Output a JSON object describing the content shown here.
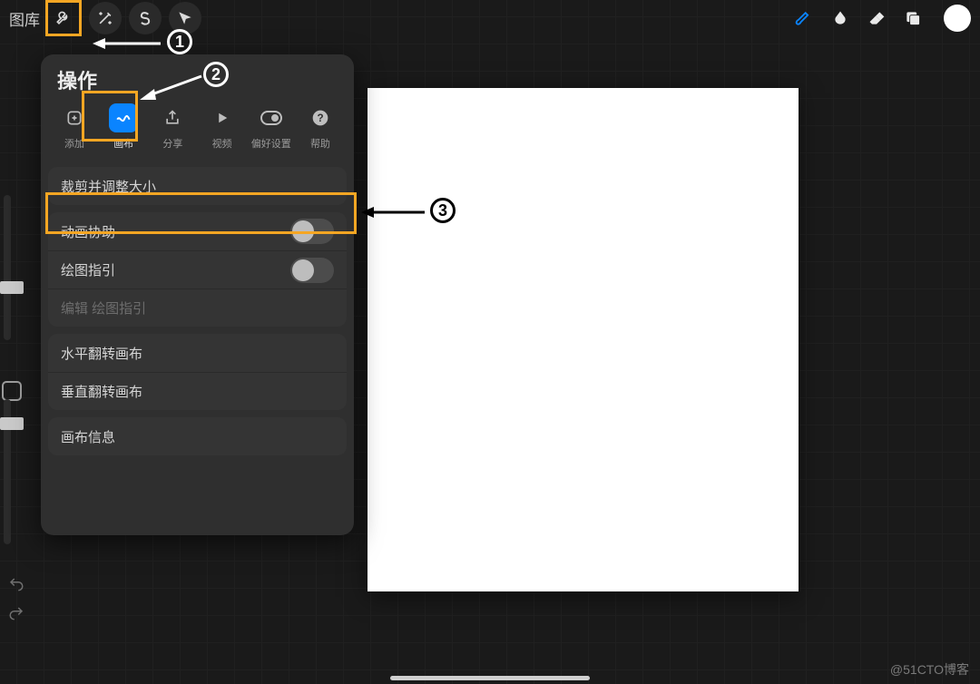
{
  "topbar": {
    "gallery_label": "图库",
    "left_tools": [
      {
        "name": "wrench-icon"
      },
      {
        "name": "wand-icon"
      },
      {
        "name": "selection-s-icon"
      },
      {
        "name": "arrow-icon"
      }
    ],
    "right_tools": [
      {
        "name": "brush-icon",
        "color": "#0a84ff"
      },
      {
        "name": "smudge-icon",
        "color": "#e9e9e9"
      },
      {
        "name": "eraser-icon",
        "color": "#e9e9e9"
      },
      {
        "name": "layers-icon",
        "color": "#e9e9e9"
      },
      {
        "name": "color-swatch",
        "color": "#ffffff"
      }
    ]
  },
  "popover": {
    "title": "操作",
    "tabs": [
      {
        "name": "add",
        "label": "添加",
        "icon": "plus-square-icon",
        "active": false
      },
      {
        "name": "canvas",
        "label": "画布",
        "icon": "wave-icon",
        "active": true
      },
      {
        "name": "share",
        "label": "分享",
        "icon": "share-icon",
        "active": false
      },
      {
        "name": "video",
        "label": "视频",
        "icon": "play-icon",
        "active": false
      },
      {
        "name": "prefs",
        "label": "偏好设置",
        "icon": "toggle-icon",
        "active": false
      },
      {
        "name": "help",
        "label": "帮助",
        "icon": "question-icon",
        "active": false
      }
    ],
    "groups": [
      [
        {
          "label": "裁剪并调整大小",
          "type": "link"
        }
      ],
      [
        {
          "label": "动画协助",
          "type": "toggle",
          "value": false
        },
        {
          "label": "绘图指引",
          "type": "toggle",
          "value": false
        },
        {
          "label": "编辑 绘图指引",
          "type": "link",
          "disabled": true
        }
      ],
      [
        {
          "label": "水平翻转画布",
          "type": "link"
        },
        {
          "label": "垂直翻转画布",
          "type": "link"
        }
      ],
      [
        {
          "label": "画布信息",
          "type": "link"
        }
      ]
    ]
  },
  "annotations": {
    "step1": "1",
    "step2": "2",
    "step3": "3"
  },
  "watermark": "@51CTO博客",
  "colors": {
    "accent": "#0a84ff",
    "highlight_box": "#f5a623"
  }
}
